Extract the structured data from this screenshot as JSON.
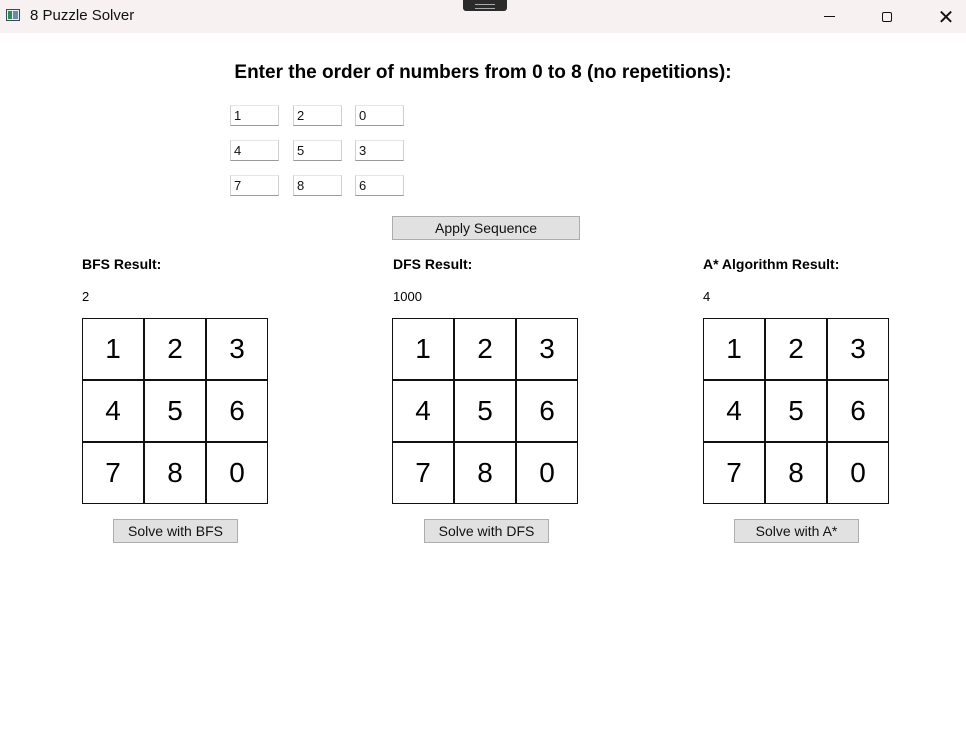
{
  "window": {
    "title": "8 Puzzle Solver",
    "minimize_icon": "minimize-icon",
    "maximize_icon": "maximize-icon",
    "close_glyph": "✕"
  },
  "heading": "Enter the order of numbers from 0 to 8 (no repetitions):",
  "inputs": [
    "1",
    "2",
    "0",
    "4",
    "5",
    "3",
    "7",
    "8",
    "6"
  ],
  "apply_button": "Apply Sequence",
  "bfs": {
    "label": "BFS Result:",
    "value": "2",
    "tiles": [
      "1",
      "2",
      "3",
      "4",
      "5",
      "6",
      "7",
      "8",
      "0"
    ],
    "button": "Solve with BFS"
  },
  "dfs": {
    "label": "DFS Result:",
    "value": "1000",
    "tiles": [
      "1",
      "2",
      "3",
      "4",
      "5",
      "6",
      "7",
      "8",
      "0"
    ],
    "button": "Solve with DFS"
  },
  "astar": {
    "label": "A* Algorithm Result:",
    "value": "4",
    "tiles": [
      "1",
      "2",
      "3",
      "4",
      "5",
      "6",
      "7",
      "8",
      "0"
    ],
    "button": "Solve with A*"
  },
  "colors": {
    "titlebar_bg": "#f7f1f2",
    "button_bg": "#e1e1e1",
    "button_border": "#adadad"
  }
}
